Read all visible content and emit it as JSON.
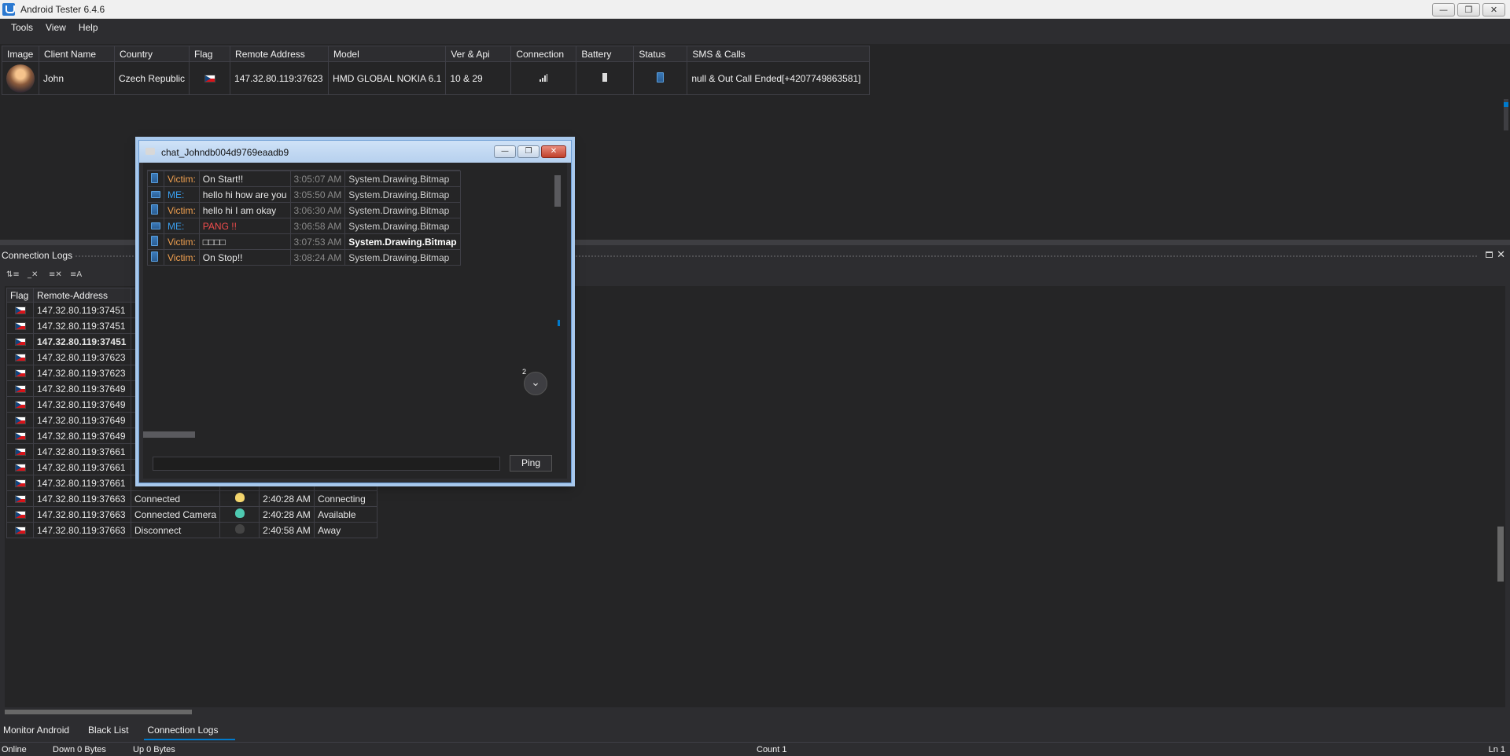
{
  "app": {
    "title": "Android Tester 6.4.6"
  },
  "window_buttons": {
    "minimize": "—",
    "restore": "❐",
    "close": "✕"
  },
  "menu": [
    "Tools",
    "View",
    "Help"
  ],
  "clients": {
    "headers": [
      "Image",
      "Client Name",
      "Country",
      "Flag",
      "Remote Address",
      "Model",
      "Ver & Api",
      "Connection",
      "Battery",
      "Status",
      "SMS & Calls"
    ],
    "rows": [
      {
        "name": "John",
        "country": "Czech Republic",
        "remote": "147.32.80.119:37623",
        "model": "HMD GLOBAL NOKIA 6.1",
        "ver": "10 & 29",
        "sms": "null & Out Call Ended[+4207749863581]"
      }
    ]
  },
  "logs": {
    "title": "Connection Logs",
    "headers": [
      "Flag",
      "Remote-Address"
    ],
    "hidden_rows": [
      "147.32.80.119:37451",
      "147.32.80.119:37451",
      "147.32.80.119:37451",
      "147.32.80.119:37623",
      "147.32.80.119:37623",
      "147.32.80.119:37649",
      "147.32.80.119:37649",
      "147.32.80.119:37649",
      "147.32.80.119:37649",
      "147.32.80.119:37661",
      "147.32.80.119:37661",
      "147.32.80.119:37661"
    ],
    "rows": [
      {
        "addr": "147.32.80.119:37663",
        "status": "Connected",
        "time": "2:40:28 AM",
        "state": "Connecting"
      },
      {
        "addr": "147.32.80.119:37663",
        "status": "Connected Camera",
        "time": "2:40:28 AM",
        "state": "Available"
      },
      {
        "addr": "147.32.80.119:37663",
        "status": "Disconnect",
        "time": "2:40:58 AM",
        "state": "Away"
      }
    ],
    "toolbar_icons": [
      "sort-icon",
      "clear-icon",
      "clear-filter-icon",
      "text-icon"
    ]
  },
  "chat": {
    "title": "chat_Johndb004d9769eaadb9",
    "messages": [
      {
        "who": "Victim:",
        "text": "On Start!!",
        "time": "3:05:07 AM",
        "img": "System.Drawing.Bitmap"
      },
      {
        "who": "ME:",
        "text": "hello hi how are you",
        "time": "3:05:50 AM",
        "img": "System.Drawing.Bitmap"
      },
      {
        "who": "Victim:",
        "text": "hello hi I am okay",
        "time": "3:06:30 AM",
        "img": "System.Drawing.Bitmap"
      },
      {
        "who": "ME:",
        "text": "PANG !!",
        "time": "3:06:58 AM",
        "img": "System.Drawing.Bitmap"
      },
      {
        "who": "Victim:",
        "text": "□□□□",
        "time": "3:07:53 AM",
        "img": "System.Drawing.Bitmap"
      },
      {
        "who": "Victim:",
        "text": "On Stop!!",
        "time": "3:08:24 AM",
        "img": "System.Drawing.Bitmap"
      }
    ],
    "badge": "2",
    "ping_label": "Ping",
    "input_value": ""
  },
  "tabs": [
    "Monitor Android",
    "Black List",
    "Connection Logs"
  ],
  "status": {
    "online": "Online",
    "down": "Down 0 Bytes",
    "up": "Up 0 Bytes",
    "count": "Count 1",
    "ln": "Ln 1"
  },
  "colors": {
    "accent": "#007acc",
    "connected": "#4ec9b0",
    "disconnect": "#f14c4c",
    "victim": "#f0a050",
    "me": "#3aa0f0"
  }
}
